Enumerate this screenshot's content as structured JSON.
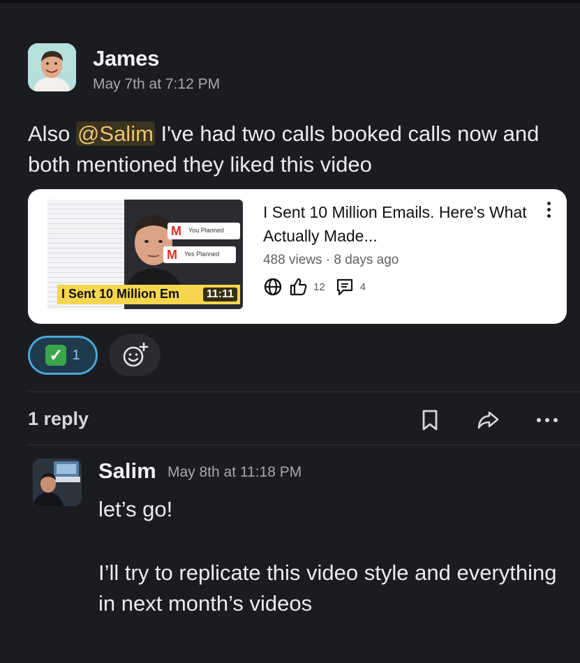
{
  "message": {
    "author": "James",
    "timestamp": "May 7th at 7:12 PM",
    "text_before": "Also ",
    "mention": "@Salim",
    "text_after": " I've had two calls booked calls now and both mentioned they liked this video"
  },
  "video": {
    "title": "I Sent 10 Million Emails. Here's What Actually Made...",
    "meta": "488 views · 8 days ago",
    "likes": "12",
    "comments": "4",
    "duration": "11:11",
    "thumbnail_caption": "I Sent 10 Million Em",
    "thumbnail_tag_1": "You Planned",
    "thumbnail_tag_2": "Yes Planned",
    "icons": [
      "globe-icon",
      "thumbs-up-icon",
      "comment-icon",
      "more-vertical-icon"
    ]
  },
  "reactions": [
    {
      "emoji": "✅",
      "count": "1"
    }
  ],
  "thread": {
    "reply_count_label": "1 reply",
    "icons": [
      "bookmark-icon",
      "share-icon",
      "more-horizontal-icon"
    ]
  },
  "reply": {
    "author": "Salim",
    "timestamp": "May 8th at 11:18 PM",
    "line1": "let’s go!",
    "body": "I’ll try to replicate this video style and everything in next month’s videos"
  },
  "colors": {
    "background": "#1b1c20",
    "mention_text": "#f0c36d",
    "mention_bg": "#3b3420",
    "reaction_border": "#4aa8d8",
    "reaction_bg": "#1f3a4d",
    "check_green": "#3aa549"
  }
}
